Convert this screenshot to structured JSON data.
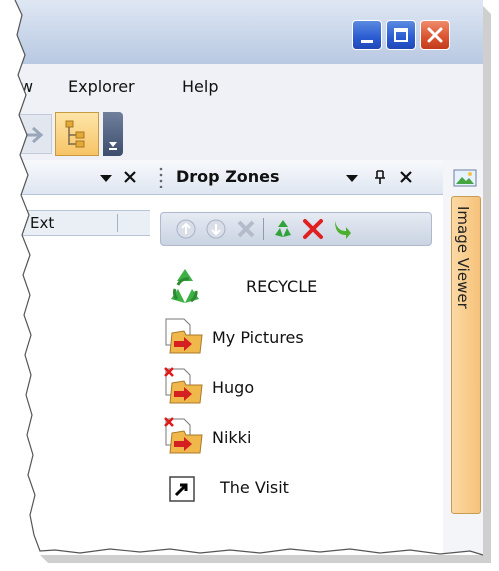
{
  "menu": {
    "partial_label": "w",
    "explorer_label": "Explorer",
    "help_label": "Help"
  },
  "left_pane": {
    "column_ext_label": "Ext"
  },
  "drop_zones": {
    "title": "Drop Zones",
    "items": [
      {
        "label": "RECYCLE",
        "icon": "recycle-icon"
      },
      {
        "label": "My Pictures",
        "icon": "folder-shortcut-icon"
      },
      {
        "label": "Hugo",
        "icon": "folder-shortcut-error-icon"
      },
      {
        "label": "Nikki",
        "icon": "folder-shortcut-error-icon"
      },
      {
        "label": "The Visit",
        "icon": "shortcut-icon"
      }
    ]
  },
  "rail": {
    "tab_label": "Image Viewer"
  },
  "colors": {
    "accent_tab": "#f6c27a",
    "close_red": "#d9512e",
    "title_blue": "#2a5bd1"
  }
}
